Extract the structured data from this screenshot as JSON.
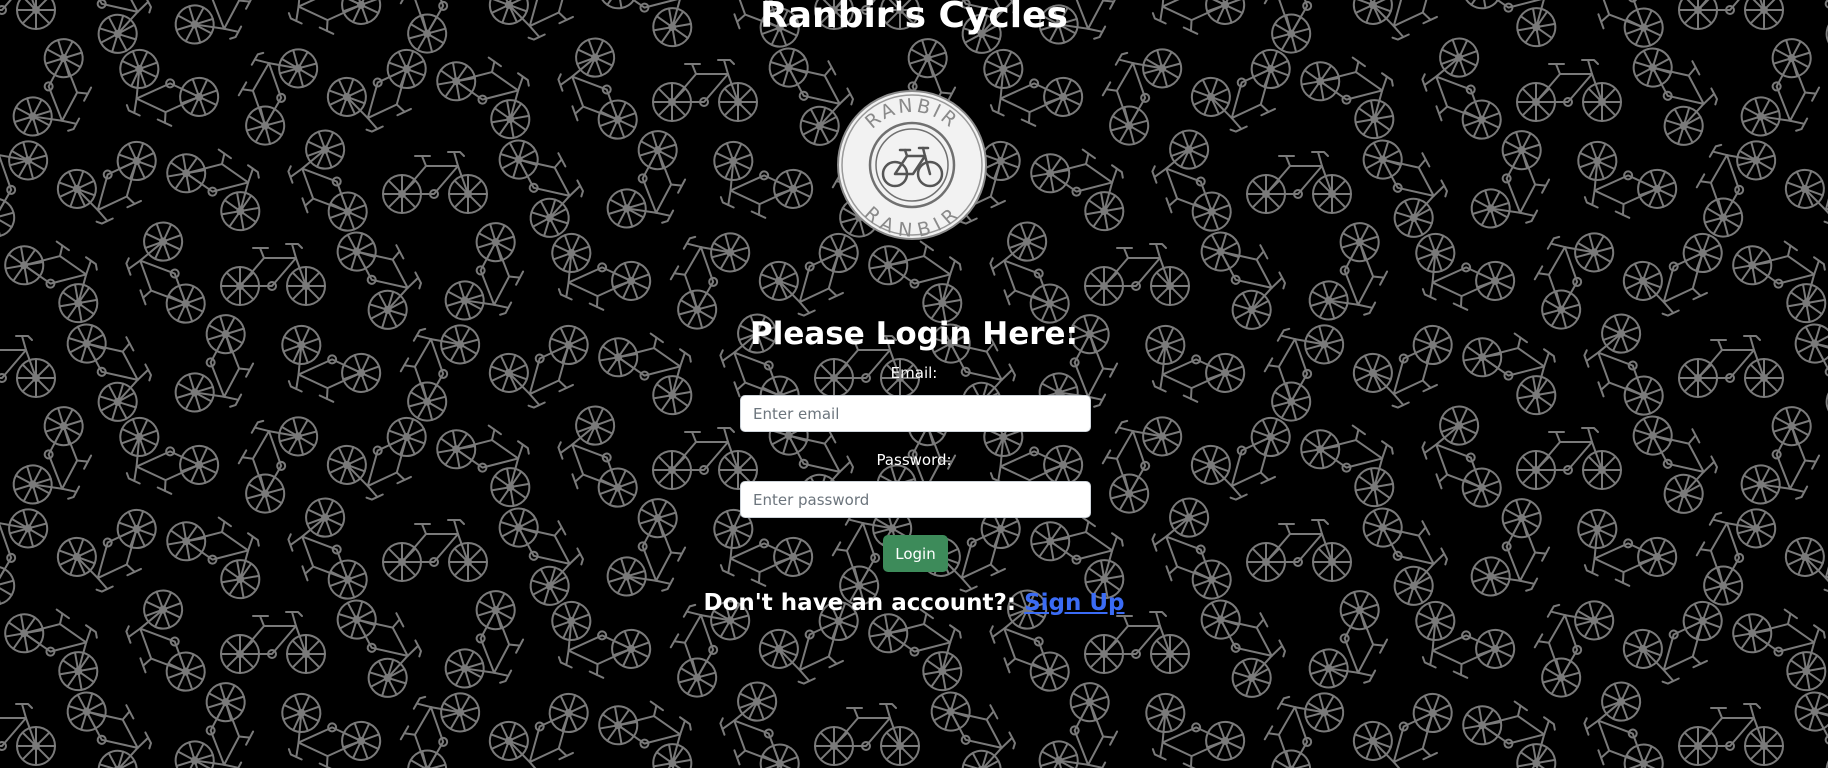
{
  "site": {
    "title": "Ranbir's Cycles",
    "logo_text_top": "RANBIR",
    "logo_text_bottom": "RANBIR"
  },
  "login": {
    "heading": "Please Login Here:",
    "email_label": "Email:",
    "email_placeholder": "Enter email",
    "email_value": "",
    "password_label": "Password:",
    "password_placeholder": "Enter password",
    "password_value": "",
    "button_label": "Login"
  },
  "signup": {
    "prompt": "Don't have an account?: ",
    "link_label": "Sign Up"
  },
  "colors": {
    "background": "#000000",
    "pattern": "#7a7a7a",
    "button": "#3d8b5a",
    "link": "#3b6cf6"
  },
  "icons": {
    "background_pattern": "bicycle-icon",
    "logo": "bicycle-icon"
  }
}
